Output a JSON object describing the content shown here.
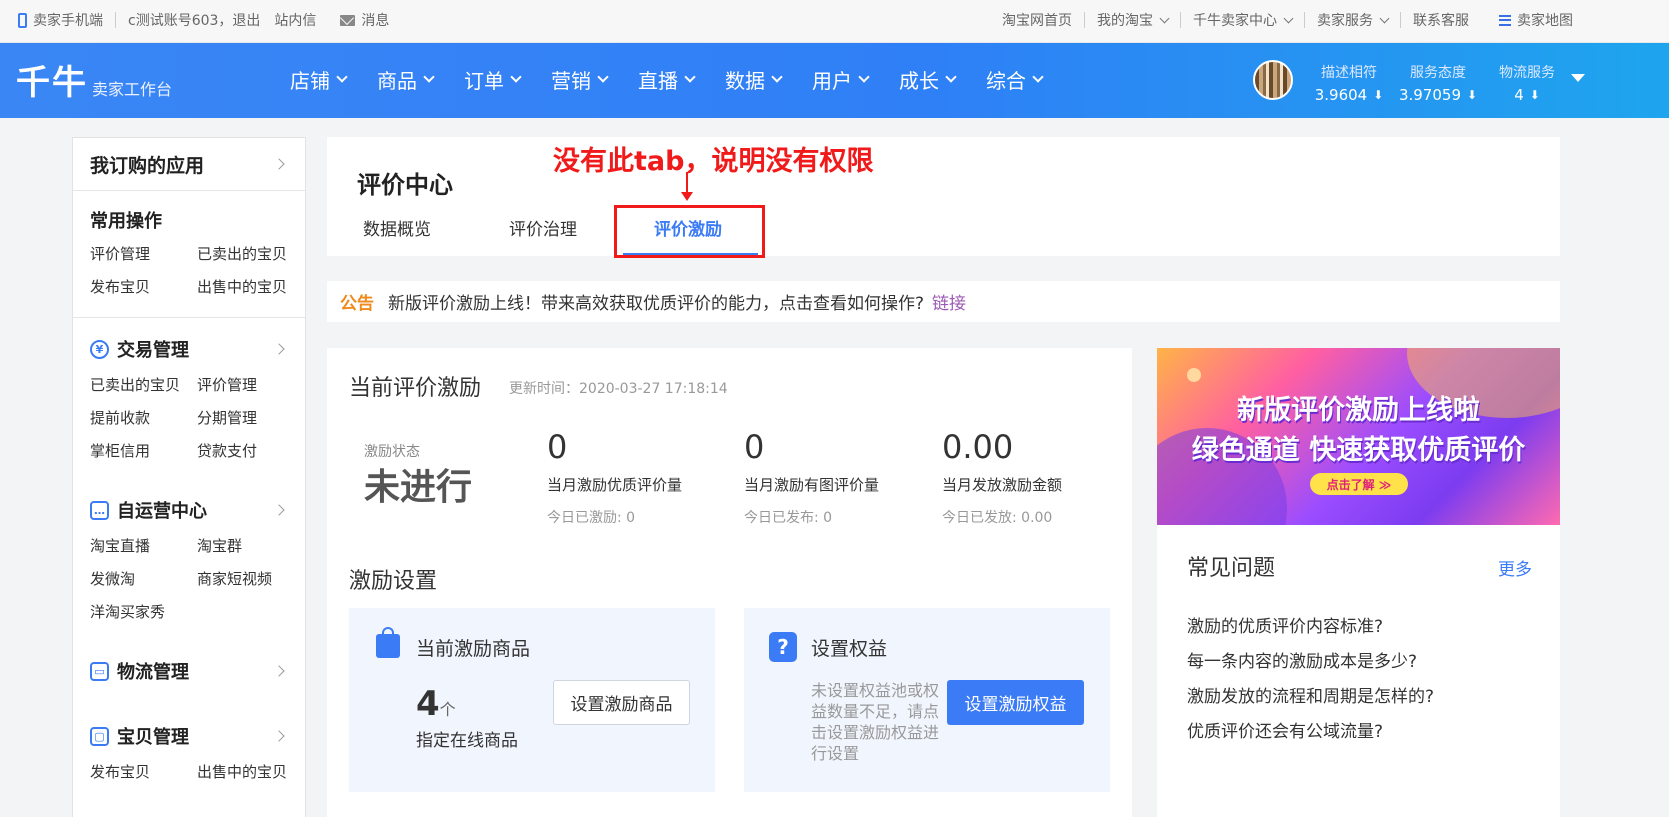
{
  "topbar": {
    "mobile": "卖家手机端",
    "account": "c测试账号603，退出",
    "inbox": "站内信",
    "messages": "消息",
    "right": [
      {
        "label": "淘宝网首页",
        "dropdown": false
      },
      {
        "label": "我的淘宝",
        "dropdown": true
      },
      {
        "label": "千牛卖家中心",
        "dropdown": true
      },
      {
        "label": "卖家服务",
        "dropdown": true
      },
      {
        "label": "联系客服",
        "dropdown": false
      }
    ],
    "sitemap": "卖家地图"
  },
  "header": {
    "logo": "千牛",
    "logo_sub": "卖家工作台",
    "nav": [
      "店铺",
      "商品",
      "订单",
      "营销",
      "直播",
      "数据",
      "用户",
      "成长",
      "综合"
    ],
    "scores": [
      {
        "label": "描述相符",
        "value": "3.9604",
        "trend": "down"
      },
      {
        "label": "服务态度",
        "value": "3.97059",
        "trend": "down"
      },
      {
        "label": "物流服务",
        "value": "4",
        "trend": "down"
      }
    ]
  },
  "sidebar": {
    "my_apps": "我订购的应用",
    "common": {
      "title": "常用操作",
      "items": [
        "评价管理",
        "已卖出的宝贝",
        "发布宝贝",
        "出售中的宝贝"
      ]
    },
    "trade": {
      "title": "交易管理",
      "items": [
        "已卖出的宝贝",
        "评价管理",
        "提前收款",
        "分期管理",
        "掌柜信用",
        "贷款支付"
      ]
    },
    "self_op": {
      "title": "自运营中心",
      "items": [
        "淘宝直播",
        "淘宝群",
        "发微淘",
        "商家短视频",
        "洋淘买家秀"
      ]
    },
    "logistics": {
      "title": "物流管理"
    },
    "goods": {
      "title": "宝贝管理",
      "items": [
        "发布宝贝",
        "出售中的宝贝"
      ]
    }
  },
  "page": {
    "title": "评价中心",
    "tabs": [
      "数据概览",
      "评价治理",
      "评价激励"
    ],
    "active_tab": "评价激励",
    "annotation": "没有此tab，说明没有权限"
  },
  "notice": {
    "tag": "公告",
    "text": "新版评价激励上线！带来高效获取优质评价的能力，点击查看如何操作?",
    "link": "链接"
  },
  "incentive": {
    "title": "当前评价激励",
    "update_time": "更新时间：2020-03-27 17:18:14",
    "status_label": "激励状态",
    "status": "未进行",
    "stats": [
      {
        "num": "0",
        "label": "当月激励优质评价量",
        "sub": "今日已激励: 0"
      },
      {
        "num": "0",
        "label": "当月激励有图评价量",
        "sub": "今日已发布: 0"
      },
      {
        "num": "0.00",
        "label": "当月发放激励金额",
        "sub": "今日已发放: 0.00"
      }
    ]
  },
  "settings": {
    "title": "激励设置",
    "goods": {
      "title": "当前激励商品",
      "count": "4",
      "unit": "个",
      "desc": "指定在线商品",
      "button": "设置激励商品"
    },
    "rights": {
      "title": "设置权益",
      "note": "未设置权益池或权益数量不足，请点击设置激励权益进行设置",
      "button": "设置激励权益"
    }
  },
  "banner": {
    "line1": "新版评价激励上线啦",
    "line2": "绿色通道 快速获取优质评价",
    "cta": "点击了解 ≫"
  },
  "faq": {
    "title": "常见问题",
    "more": "更多",
    "items": [
      "激励的优质评价内容标准?",
      "每一条内容的激励成本是多少?",
      "激励发放的流程和周期是怎样的?",
      "优质评价还会有公域流量?"
    ]
  },
  "colors": {
    "brand_blue": "#3b7bf6",
    "annotation_red": "#f01a1a",
    "notice_orange": "#f08a1c"
  }
}
